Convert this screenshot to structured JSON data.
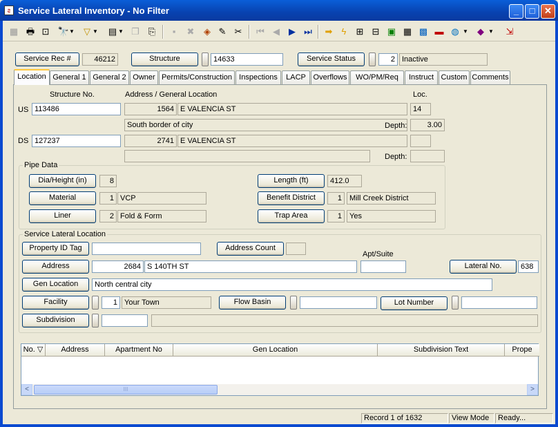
{
  "window": {
    "title": "Service Lateral Inventory - No Filter",
    "min_glyph": "_",
    "max_glyph": "□",
    "close_glyph": "✕"
  },
  "toolbar": {
    "icons": [
      "new-record-icon",
      "print-icon",
      "print-preview-icon",
      "find-icon",
      "filter-icon",
      "report-icon",
      "copy-icon",
      "paste-icon",
      "delete-icon",
      "cancel-icon",
      "save-icon",
      "edit-icon",
      "cut-icon",
      "first-record-icon",
      "previous-record-icon",
      "next-record-icon",
      "last-record-icon",
      "goto-icon",
      "lightning-icon",
      "map-icon",
      "tree-icon",
      "chart-icon",
      "calculator-icon",
      "grid-icon",
      "flag-icon",
      "globe-icon",
      "book-icon",
      "exit-icon"
    ]
  },
  "header": {
    "service_rec_label": "Service Rec #",
    "service_rec_value": "46212",
    "structure_label": "Structure",
    "structure_value": "14633",
    "service_status_label": "Service Status",
    "service_status_code": "2",
    "service_status_text": "Inactive"
  },
  "tabs": [
    {
      "label": "Location"
    },
    {
      "label": "General 1"
    },
    {
      "label": "General 2"
    },
    {
      "label": "Owner"
    },
    {
      "label": "Permits/Construction"
    },
    {
      "label": "Inspections"
    },
    {
      "label": "LACP"
    },
    {
      "label": "Overflows"
    },
    {
      "label": "WO/PM/Req"
    },
    {
      "label": "Instruct"
    },
    {
      "label": "Custom"
    },
    {
      "label": "Comments"
    }
  ],
  "location": {
    "structure_no_label": "Structure No.",
    "address_label": "Address / General Location",
    "loc_label": "Loc.",
    "us_label": "US",
    "us_structure": "113486",
    "us_number": "1564",
    "us_street": "E VALENCIA ST",
    "us_loc": "14",
    "us_general": "South border of city",
    "depth_label": "Depth:",
    "us_depth": "3.00",
    "ds_label": "DS",
    "ds_structure": "127237",
    "ds_number": "2741",
    "ds_street": "E VALENCIA ST",
    "ds_loc": "",
    "ds_general": "",
    "ds_depth": ""
  },
  "pipe": {
    "group_title": "Pipe Data",
    "dia_label": "Dia/Height (in)",
    "dia_value": "8",
    "material_label": "Material",
    "material_code": "1",
    "material_text": "VCP",
    "liner_label": "Liner",
    "liner_code": "2",
    "liner_text": "Fold & Form",
    "length_label": "Length (ft)",
    "length_value": "412.0",
    "benefit_label": "Benefit District",
    "benefit_code": "1",
    "benefit_text": "Mill Creek District",
    "trap_label": "Trap Area",
    "trap_code": "1",
    "trap_text": "Yes"
  },
  "lateral": {
    "group_title": "Service Lateral Location",
    "property_id_label": "Property ID Tag",
    "property_id_value": "",
    "address_count_label": "Address Count",
    "address_count_value": "",
    "apt_suite_label": "Apt/Suite",
    "apt_suite_value": "",
    "address_label": "Address",
    "address_number": "2684",
    "address_street": "S 140TH ST",
    "lateral_no_label": "Lateral No.",
    "lateral_no_value": "638",
    "gen_location_label": "Gen Location",
    "gen_location_value": "North central city",
    "facility_label": "Facility",
    "facility_code": "1",
    "facility_text": "Your Town",
    "flow_basin_label": "Flow Basin",
    "flow_basin_value": "",
    "lot_number_label": "Lot Number",
    "lot_number_value": "",
    "subdivision_label": "Subdivision",
    "subdivision_code": "",
    "subdivision_text": ""
  },
  "grid": {
    "columns": [
      "No. ▽",
      "Address",
      "Apartment No",
      "Gen Location",
      "Subdivision Text",
      "Prope"
    ],
    "scroll_thumb": "III",
    "left_arrow": "<",
    "right_arrow": ">"
  },
  "status": {
    "record": "Record 1 of 1632",
    "mode": "View Mode",
    "ready": "Ready..."
  }
}
